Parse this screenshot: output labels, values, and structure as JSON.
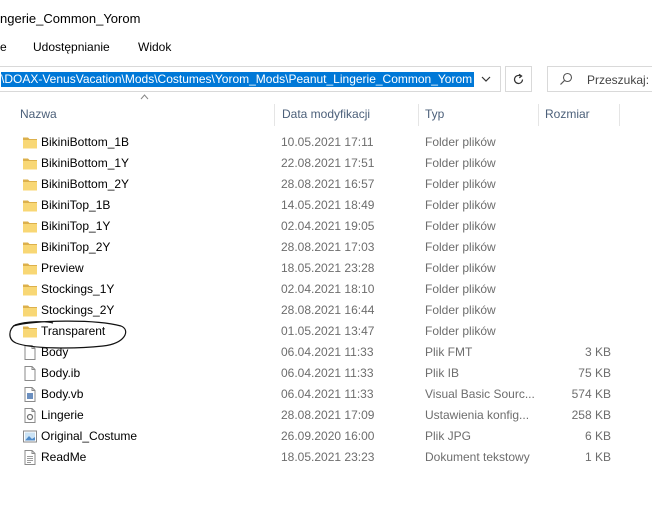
{
  "window": {
    "title": "ngerie_Common_Yorom"
  },
  "ribbon": {
    "tabs": [
      "e",
      "Udostępnianie",
      "Widok"
    ]
  },
  "address_bar": {
    "path": "\\DOAX-VenusVacation\\Mods\\Costumes\\Yorom_Mods\\Peanut_Lingerie_Common_Yorom"
  },
  "search": {
    "placeholder": "Przeszukaj: P"
  },
  "columns": {
    "name": "Nazwa",
    "date": "Data modyfikacji",
    "type": "Typ",
    "size": "Rozmiar"
  },
  "files": [
    {
      "name": "BikiniBottom_1B",
      "date": "10.05.2021 17:11",
      "type": "Folder plików",
      "size": "",
      "icon": "folder-icon"
    },
    {
      "name": "BikiniBottom_1Y",
      "date": "22.08.2021 17:51",
      "type": "Folder plików",
      "size": "",
      "icon": "folder-icon"
    },
    {
      "name": "BikiniBottom_2Y",
      "date": "28.08.2021 16:57",
      "type": "Folder plików",
      "size": "",
      "icon": "folder-icon"
    },
    {
      "name": "BikiniTop_1B",
      "date": "14.05.2021 18:49",
      "type": "Folder plików",
      "size": "",
      "icon": "folder-icon"
    },
    {
      "name": "BikiniTop_1Y",
      "date": "02.04.2021 19:05",
      "type": "Folder plików",
      "size": "",
      "icon": "folder-icon"
    },
    {
      "name": "BikiniTop_2Y",
      "date": "28.08.2021 17:03",
      "type": "Folder plików",
      "size": "",
      "icon": "folder-icon"
    },
    {
      "name": "Preview",
      "date": "18.05.2021 23:28",
      "type": "Folder plików",
      "size": "",
      "icon": "folder-icon"
    },
    {
      "name": "Stockings_1Y",
      "date": "02.04.2021 18:10",
      "type": "Folder plików",
      "size": "",
      "icon": "folder-icon"
    },
    {
      "name": "Stockings_2Y",
      "date": "28.08.2021 16:44",
      "type": "Folder plików",
      "size": "",
      "icon": "folder-icon"
    },
    {
      "name": "Transparent",
      "date": "01.05.2021 13:47",
      "type": "Folder plików",
      "size": "",
      "icon": "folder-icon"
    },
    {
      "name": "Body",
      "date": "06.04.2021 11:33",
      "type": "Plik FMT",
      "size": "3 KB",
      "icon": "file-icon"
    },
    {
      "name": "Body.ib",
      "date": "06.04.2021 11:33",
      "type": "Plik IB",
      "size": "75 KB",
      "icon": "file-icon"
    },
    {
      "name": "Body.vb",
      "date": "06.04.2021 11:33",
      "type": "Visual Basic Sourc...",
      "size": "574 KB",
      "icon": "vb-file-icon"
    },
    {
      "name": "Lingerie",
      "date": "28.08.2021 17:09",
      "type": "Ustawienia konfig...",
      "size": "258 KB",
      "icon": "config-file-icon"
    },
    {
      "name": "Original_Costume",
      "date": "26.09.2020 16:00",
      "type": "Plik JPG",
      "size": "6 KB",
      "icon": "image-file-icon"
    },
    {
      "name": "ReadMe",
      "date": "18.05.2021 23:23",
      "type": "Dokument tekstowy",
      "size": "1 KB",
      "icon": "text-file-icon"
    }
  ]
}
